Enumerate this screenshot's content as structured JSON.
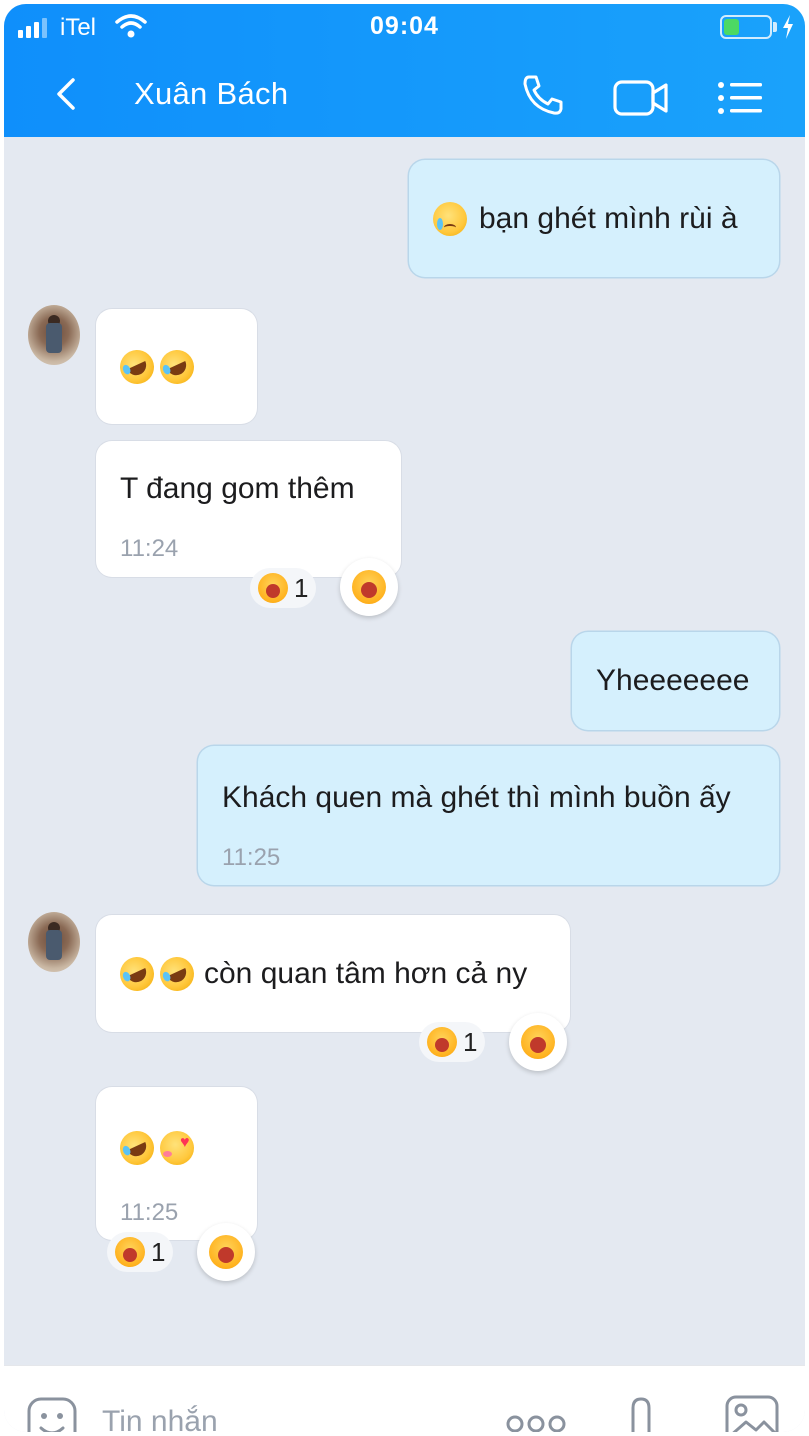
{
  "status_bar": {
    "carrier": "iTel",
    "time": "09:04",
    "battery_level": 0.35
  },
  "header": {
    "back_icon": "chevron-left-icon",
    "contact_name": "Xuân Bách",
    "actions": [
      "phone-icon",
      "video-camera-icon",
      "menu-list-icon"
    ]
  },
  "messages": [
    {
      "side": "out",
      "emoji": [
        "crying-face"
      ],
      "text": "bạn ghét mình rùi à"
    },
    {
      "side": "in",
      "emoji": [
        "rolling-on-floor-laughing",
        "rolling-on-floor-laughing"
      ],
      "text": ""
    },
    {
      "side": "in",
      "text": "T đang gom thêm",
      "time": "11:24",
      "reaction_count": "1"
    },
    {
      "side": "out",
      "text": "Yheeeeeee"
    },
    {
      "side": "out",
      "text": "Khách quen mà ghét thì mình buồn ấy",
      "time": "11:25"
    },
    {
      "side": "in",
      "emoji": [
        "rolling-on-floor-laughing",
        "rolling-on-floor-laughing"
      ],
      "text": "còn quan tâm hơn cả ny",
      "reaction_count": "1"
    },
    {
      "side": "in",
      "emoji": [
        "rolling-on-floor-laughing",
        "smiling-face-with-hearts"
      ],
      "text": "",
      "time": "11:25",
      "reaction_count": "1"
    }
  ],
  "composer": {
    "placeholder": "Tin nhắn",
    "icons": [
      "sticker-icon",
      "more-icon",
      "attach-icon",
      "image-icon"
    ]
  },
  "colors": {
    "header": "#1aa2fb",
    "background": "#e4e9f1",
    "outgoing_bubble": "#d5f0fd",
    "incoming_bubble": "#ffffff"
  }
}
